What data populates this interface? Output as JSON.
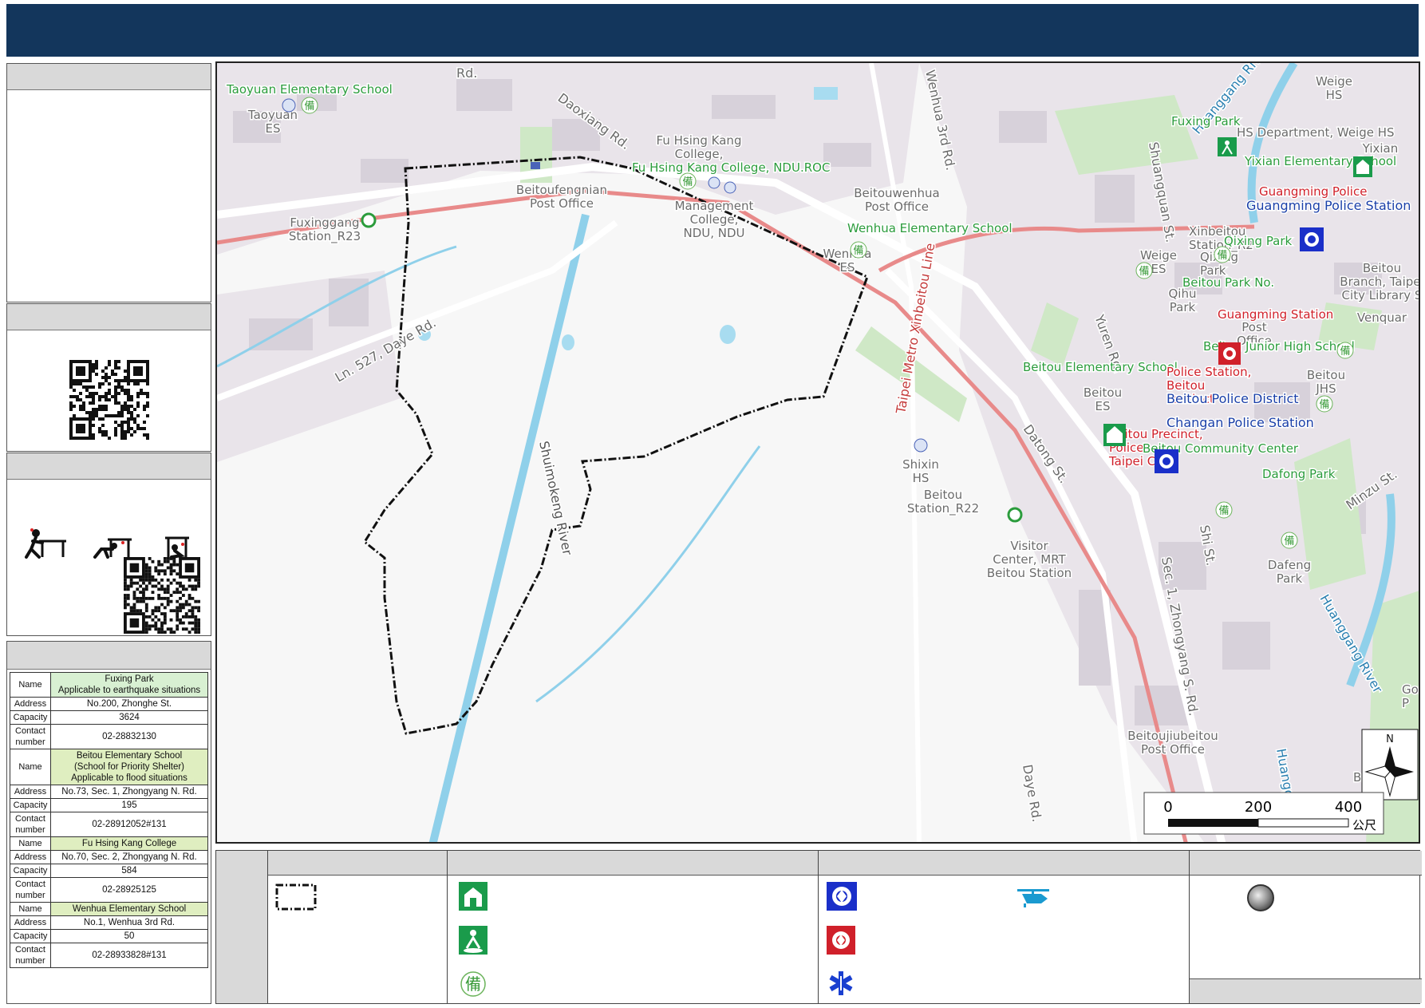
{
  "map": {
    "place_labels": {
      "taoyuan_es_full": "Taoyuan Elementary School",
      "taoyuan_es": "Taoyuan\nES",
      "fuxinggang_station": "Fuxinggang\nStation_R23",
      "post_fengnian": "Beitoufengnian\nPost Office",
      "fhk_college": "Fu Hsing Kang\nCollege,",
      "fhk_college_ndu": "Fu Hsing Kang College, NDU.ROC",
      "management_college": "Management\nCollege,\nNDU, NDU",
      "wenhua_post": "Beitouwenhua\nPost Office",
      "wenhua_es_full": "Wenhua Elementary School",
      "wenhua_es": "Wenhua\nES",
      "daoxiang": "Daoxiang Rd.",
      "wenhua3": "Wenhua 3rd Rd.",
      "daye_ln": "Ln. 527, Daye Rd.",
      "rd_top": "Rd.",
      "shuimokeng": "Shuimokeng River",
      "xinbeitou_line": "Taipei Metro Xinbeitou Line",
      "shixin_hs": "Shixin\nHS",
      "beitou_station": "Beitou\nStation_R22",
      "visitor_center": "Visitor\nCenter, MRT\nBeitou Station",
      "datong": "Datong St.",
      "yuren": "Yuren Rd.",
      "zhongyang": "Sec. 1, Zhongyang S. Rd.",
      "shi_st": "Shi St.",
      "daye_rd": "Daye Rd.",
      "jiubeitou_post": "Beitoujiubeitou\nPost Office",
      "huanggang": "Huanggang River",
      "huanggang2": "Huanggang River",
      "shuangquan": "Shuangquan St.",
      "weige_hs": "Weige\nHS",
      "fuxing_park": "Fuxing Park",
      "hs_department": "HS Department, Weige HS",
      "yixian": "Yixian",
      "yixian_es": "Yixian Elementary School",
      "guangming_police_red": "Guangming Police",
      "guangming_police_station": "Guangming Police Station",
      "xinbeitou_station": "Xinbeitou\nStation_R2",
      "qixing_park": "Qixing Park",
      "qixing_park2": "Qixing\nPark",
      "weige_es": "Weige\nES",
      "beitou_park": "Beitou Park No.",
      "branch_library": "Beitou\nBranch, Taipei\nCity Library S",
      "qihu_park": "Qihu\nPark",
      "guangming_station": "Guangming Station",
      "post_office": "Post\nOffice",
      "venquar": "Venquar",
      "beitou_jhs": "Beitou Junior High School",
      "beitou_jhs2": "Beitou\nJHS",
      "beitou_es_full": "Beitou Elementary School",
      "beitou_es": "Beitou\nES",
      "police_station_partial": "Police Station,\nBeitou\nPrecinct",
      "beitou_police_district": "Beitou Police District",
      "changan_police": "Changan Police Station",
      "beitou_precinct": "Beitou Precinct,\nPolice\nTaipei City",
      "community_center": "Beitou Community Center",
      "minzu": "Minzu St.",
      "dafong_park": "Dafong Park",
      "dafeng_park": "Dafeng\nPark",
      "gon": "Gon\nP",
      "bran": "Bran",
      "huanggang_partial": "Huanggan"
    },
    "scale": {
      "ticks": [
        "0",
        "200",
        "400"
      ],
      "unit": "公尺"
    },
    "north": "N"
  },
  "info_table": [
    {
      "rows": [
        {
          "label": "Name",
          "value": "Fuxing Park\nApplicable to earthquake situations",
          "style": "hl-a"
        },
        {
          "label": "Address",
          "value": "No.200, Zhonghe St."
        },
        {
          "label": "Capacity",
          "value": "3624"
        },
        {
          "label": "Contact\nnumber",
          "value": "02-28832130"
        }
      ]
    },
    {
      "rows": [
        {
          "label": "Name",
          "value": "Beitou Elementary School\n(School for Priority Shelter)\nApplicable to flood situations",
          "style": "hl-b"
        },
        {
          "label": "Address",
          "value": "No.73, Sec. 1, Zhongyang N. Rd."
        },
        {
          "label": "Capacity",
          "value": "195"
        },
        {
          "label": "Contact\nnumber",
          "value": "02-28912052#131"
        }
      ]
    },
    {
      "rows": [
        {
          "label": "Name",
          "value": "Fu Hsing Kang College",
          "style": "hl-b"
        },
        {
          "label": "Address",
          "value": "No.70, Sec. 2, Zhongyang N. Rd."
        },
        {
          "label": "Capacity",
          "value": "584"
        },
        {
          "label": "Contact\nnumber",
          "value": "02-28925125"
        }
      ]
    },
    {
      "rows": [
        {
          "label": "Name",
          "value": "Wenhua Elementary School",
          "style": "hl-b"
        },
        {
          "label": "Address",
          "value": "No.1, Wenhua 3rd Rd."
        },
        {
          "label": "Capacity",
          "value": "50"
        },
        {
          "label": "Contact\nnumber",
          "value": "02-28933828#131"
        }
      ]
    }
  ],
  "icons": {
    "boundary": "dashed-boundary-icon",
    "shelter_school": "green-school-shelter-icon",
    "shelter_park": "green-park-shelter-icon",
    "reserve": "備",
    "police_blue": "blue-police-icon",
    "police_red": "red-police-icon",
    "medical": "star-of-life-icon",
    "helicopter": "helicopter-icon",
    "circle": "gray-circle-icon"
  },
  "colors": {
    "header": "#13365c",
    "shelter_green": "#1a9b4b",
    "police_blue": "#1a2fc9",
    "police_red": "#d0202a",
    "metro_line": "#e88a8a",
    "river": "#8fd0ea",
    "boundary": "#111111"
  }
}
